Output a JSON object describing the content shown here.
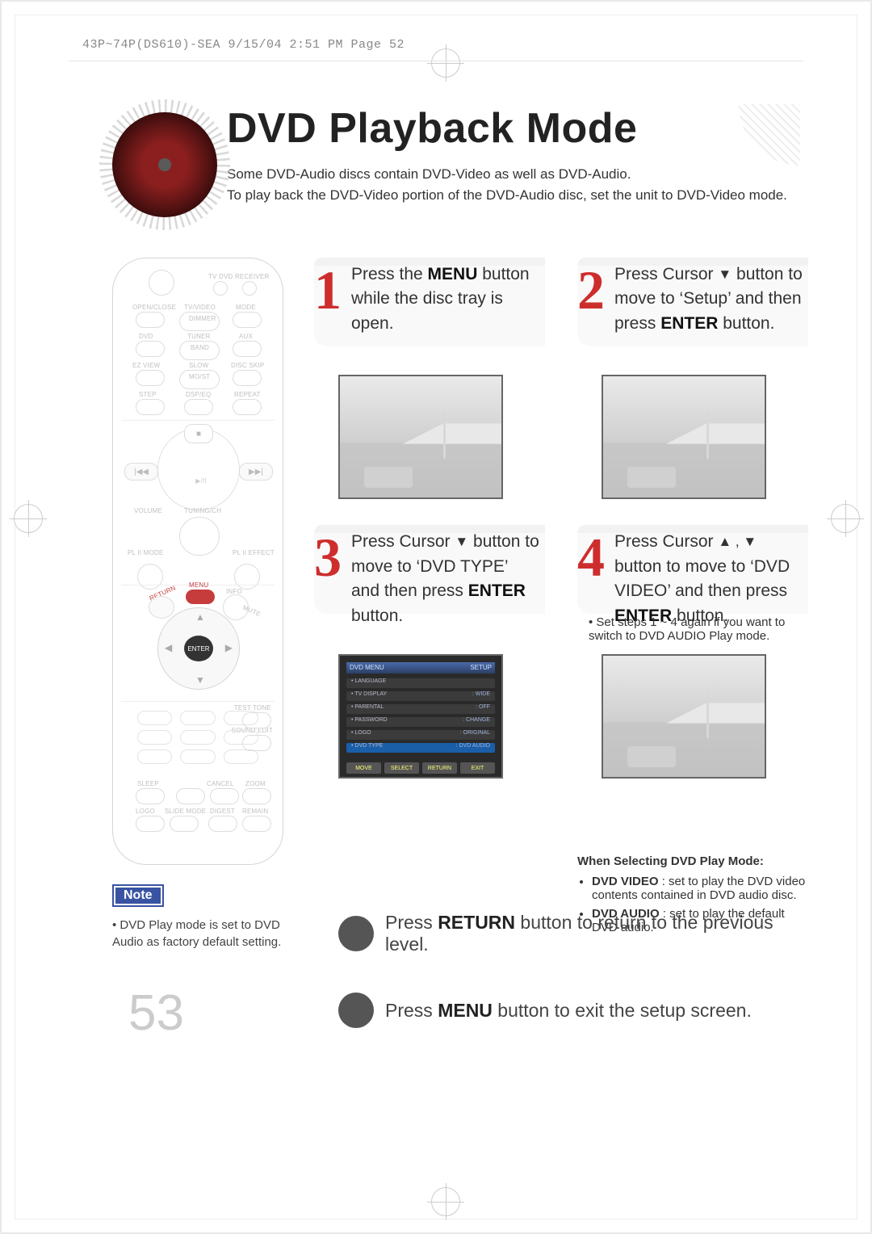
{
  "slug": "43P~74P(DS610)-SEA  9/15/04 2:51 PM  Page 52",
  "page_number": "53",
  "title": "DVD Playback Mode",
  "lead_line_1": "Some DVD-Audio discs contain DVD-Video as well as DVD-Audio.",
  "lead_line_2": "To play back the DVD-Video portion of the DVD-Audio disc, set the unit to DVD-Video mode.",
  "steps": {
    "s1": {
      "num": "1",
      "a": "Press the ",
      "b": "MENU",
      "c": " button while the disc tray is open."
    },
    "s2": {
      "num": "2",
      "a": "Press Cursor ",
      "b": "▼",
      "c": " button to move to ‘Setup’ and then press ",
      "d": "ENTER",
      "e": " button."
    },
    "s3": {
      "num": "3",
      "a": "Press Cursor ",
      "b": "▼",
      "c": " button to move to ‘DVD TYPE’ and then press ",
      "d": "ENTER",
      "e": " button."
    },
    "s4": {
      "num": "4",
      "a": "Press Cursor ",
      "b": "▲ , ▼",
      "c": " button to move to ‘DVD VIDEO’ and then press ",
      "d": "ENTER",
      "e": " button."
    }
  },
  "step4_note": "Set steps 1 ~ 4 again if you want to switch to DVD AUDIO Play mode.",
  "menu": {
    "title_l": "DVD MENU",
    "title_r": "SETUP",
    "items": [
      {
        "l": "• LANGUAGE",
        "r": ""
      },
      {
        "l": "• TV DISPLAY",
        "r": ": WIDE"
      },
      {
        "l": "• PARENTAL",
        "r": ": OFF"
      },
      {
        "l": "• PASSWORD",
        "r": ": CHANGE"
      },
      {
        "l": "• LOGO",
        "r": ": ORIGINAL"
      },
      {
        "l": "• DVD TYPE",
        "r": ": DVD AUDIO"
      }
    ],
    "footer": [
      "MOVE",
      "SELECT",
      "RETURN",
      "EXIT"
    ]
  },
  "select": {
    "heading": "When Selecting DVD Play Mode:",
    "video_label": "DVD VIDEO",
    "video_desc": ": set to play the DVD video contents contained in DVD audio disc.",
    "audio_label": "DVD AUDIO",
    "audio_desc": ": set to play the default DVD audio."
  },
  "note": {
    "badge": "Note",
    "text": "DVD Play mode is set to DVD Audio as factory default setting."
  },
  "returns": {
    "ret_a": "Press ",
    "ret_b": "RETURN",
    "ret_c": " button to return to the previous level.",
    "menu_a": "Press ",
    "menu_b": "MENU",
    "menu_c": " button to exit the setup screen."
  },
  "remote_labels": {
    "tv": "TV   DVD RECEIVER",
    "open": "OPEN/CLOSE",
    "tvvid": "TV/VIDEO",
    "mode": "MODE",
    "dimmer": "DIMMER",
    "dvd": "DVD",
    "tuner": "TUNER",
    "aux": "AUX",
    "band": "BAND",
    "ezview": "EZ VIEW",
    "slow": "SLOW",
    "dskip": "DISC SKIP",
    "most": "MO/ST",
    "step": "STEP",
    "dspeq": "DSP/EQ",
    "repeat": "REPEAT",
    "volume": "VOLUME",
    "tune": "TUNING/CH",
    "plmode": "PL II MODE",
    "pleff": "PL II EFFECT",
    "return": "RETURN",
    "menu": "MENU",
    "info": "INFO",
    "mute": "MUTE",
    "enter": "ENTER",
    "test": "TEST TONE",
    "sedit": "SOUND EDIT",
    "sleep": "SLEEP",
    "cancel": "CANCEL",
    "zoom": "ZOOM",
    "logo": "LOGO",
    "smode": "SLIDE MODE",
    "digest": "DIGEST",
    "remain": "REMAIN"
  }
}
